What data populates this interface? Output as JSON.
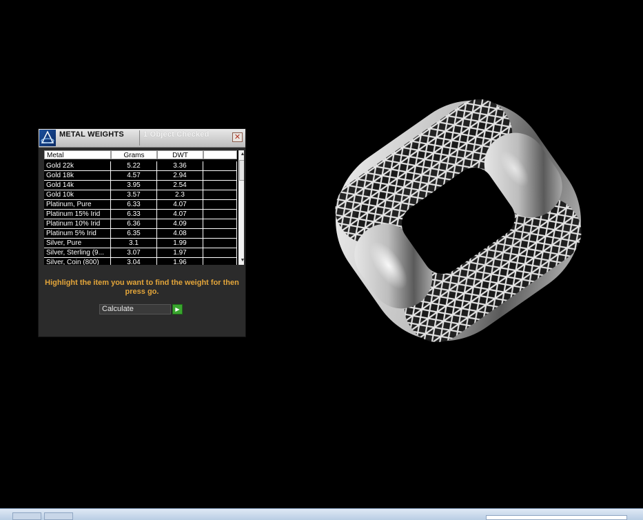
{
  "panel": {
    "title": "METAL WEIGHTS",
    "status": "1 Object Checked",
    "close_glyph": "✕",
    "columns": [
      "Metal",
      "Grams",
      "DWT",
      ""
    ],
    "rows": [
      {
        "metal": "Gold 22k",
        "grams": "5.22",
        "dwt": "3.36"
      },
      {
        "metal": "Gold 18k",
        "grams": "4.57",
        "dwt": "2.94"
      },
      {
        "metal": "Gold 14k",
        "grams": "3.95",
        "dwt": "2.54"
      },
      {
        "metal": "Gold 10k",
        "grams": "3.57",
        "dwt": "2.3"
      },
      {
        "metal": "Platinum, Pure",
        "grams": "6.33",
        "dwt": "4.07"
      },
      {
        "metal": "Platinum 15% Irid",
        "grams": "6.33",
        "dwt": "4.07"
      },
      {
        "metal": "Platinum 10% Irid",
        "grams": "6.36",
        "dwt": "4.09"
      },
      {
        "metal": "Platinum 5% Irid",
        "grams": "6.35",
        "dwt": "4.08"
      },
      {
        "metal": "Silver, Pure",
        "grams": "3.1",
        "dwt": "1.99"
      },
      {
        "metal": "Silver, Sterling (9...",
        "grams": "3.07",
        "dwt": "1.97"
      },
      {
        "metal": "Silver, Coin (800)",
        "grams": "3.04",
        "dwt": "1.96"
      }
    ],
    "instruction": "Highlight the item you want to find the weight for then press go.",
    "calculate_label": "Calculate",
    "go_glyph": "▶",
    "icons": {
      "app": "app-logo-icon",
      "close": "close-icon",
      "go": "go-arrow-icon"
    }
  },
  "colors": {
    "instruction": "#e3a53a",
    "go_button": "#3aa62f",
    "panel_bg": "#2b2b2b"
  }
}
